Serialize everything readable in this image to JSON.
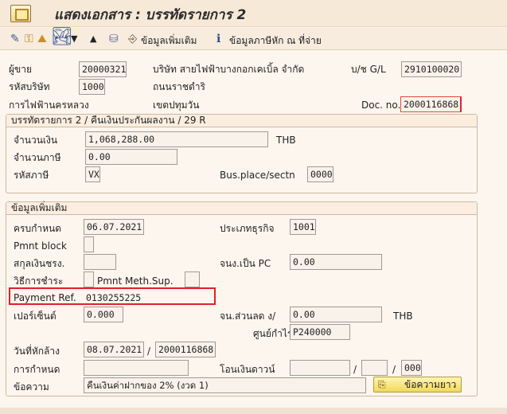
{
  "window": {
    "title": "แสดงเอกสาร : บรรทัดรายการ 2"
  },
  "toolbar": {
    "more_data_label": "ข้อมูลเพิ่มเติม",
    "withholding_tax_label": "ข้อมูลภาษีหัก ณ ที่จ่าย"
  },
  "header": {
    "vendor_label": "ผู้ขาย",
    "vendor_value": "20000321",
    "vendor_name": "บริษัท สายไฟฟ้าบางกอกเคเบิ้ล จำกัด",
    "gl_label": "บ/ช G/L",
    "gl_value": "2910100020",
    "company_code_label": "รหัสบริษัท",
    "company_code_value": "1000",
    "street": "ถนนราชดำริ",
    "authority": "การไฟฟ้านครหลวง",
    "district": "เขตปทุมวัน",
    "doc_no_label": "Doc. no.",
    "doc_no_value": "2000116868"
  },
  "line_item_group": {
    "title": "บรรทัดรายการ 2 / คืนเงินประกันผลงาน / 29 R",
    "amount_label": "จำนวนเงิน",
    "amount_value": "1,068,288.00",
    "currency": "THB",
    "tax_amount_label": "จำนวนภาษี",
    "tax_amount_value": "0.00",
    "tax_code_label": "รหัสภาษี",
    "tax_code_value": "VX",
    "bus_place_label": "Bus.place/sectn",
    "bus_place_value": "0000"
  },
  "more_data_group": {
    "title": "ข้อมูลเพิ่มเติม",
    "due_date_label": "ครบกำหนด",
    "due_date_value": "06.07.2021",
    "business_type_label": "ประเภทธุรกิจ",
    "business_type_value": "1001",
    "pmnt_block_label": "Pmnt block",
    "pmnt_block_value": "",
    "currency_label": "สกุลเงินชรง.",
    "currency_value": "",
    "pc_amount_label": "จนง.เป็น PC",
    "pc_amount_value": "0.00",
    "pay_method_label": "วิธีการชำระ",
    "pay_method_value": "",
    "pmnt_meth_sup_label": "Pmnt Meth.Sup.",
    "pmnt_meth_sup_value": "",
    "payment_ref_label": "Payment Ref.",
    "payment_ref_value": "0130255225",
    "percent_label": "เปอร์เซ็นต์",
    "percent_value": "0.000",
    "discount_amount_label": "จน.ส่วนลด ง/",
    "discount_amount_value": "0.00",
    "discount_currency": "THB",
    "profit_center_label": "ศูนย์กำไร",
    "profit_center_value": "P240000",
    "deduction_date_label": "วันที่หักล้าง",
    "deduction_date_value": "08.07.2021",
    "deduction_doc_value": "2000116868",
    "assignment_label": "การกำหนด",
    "assignment_value": "",
    "transfer_label": "โอนเงินดาวน์",
    "transfer_value_1": "",
    "transfer_value_2": "",
    "transfer_value_3": "000",
    "text_label": "ข้อความ",
    "text_value": "คืนเงินค่าฝากของ 2% (งวด 1)",
    "long_text_button": "ข้อความยาว"
  },
  "colors": {
    "highlight": "#e0202a",
    "background": "#fdf6ee"
  },
  "icons": [
    "app-document-icon",
    "pencil-glasses-icon",
    "key-icon",
    "mountain-icon",
    "triangle-down-icon",
    "triangle-up-icon",
    "stamp-icon",
    "more-data-icon",
    "info-icon",
    "long-text-icon"
  ]
}
